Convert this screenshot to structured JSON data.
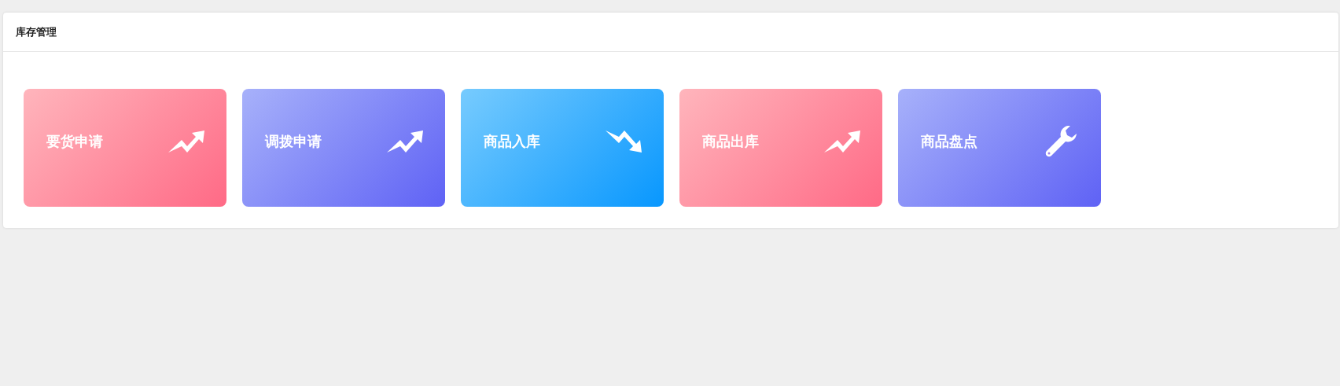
{
  "panel": {
    "title": "库存管理"
  },
  "cards": [
    {
      "label": "要货申请",
      "kind": "up",
      "color": "#ff6a86"
    },
    {
      "label": "调拨申请",
      "kind": "up",
      "color": "#5f62f5"
    },
    {
      "label": "商品入库",
      "kind": "down",
      "color": "#0897fe"
    },
    {
      "label": "商品出库",
      "kind": "up",
      "color": "#ff6a86"
    },
    {
      "label": "商品盘点",
      "kind": "tool",
      "color": "#5f62f5"
    }
  ]
}
